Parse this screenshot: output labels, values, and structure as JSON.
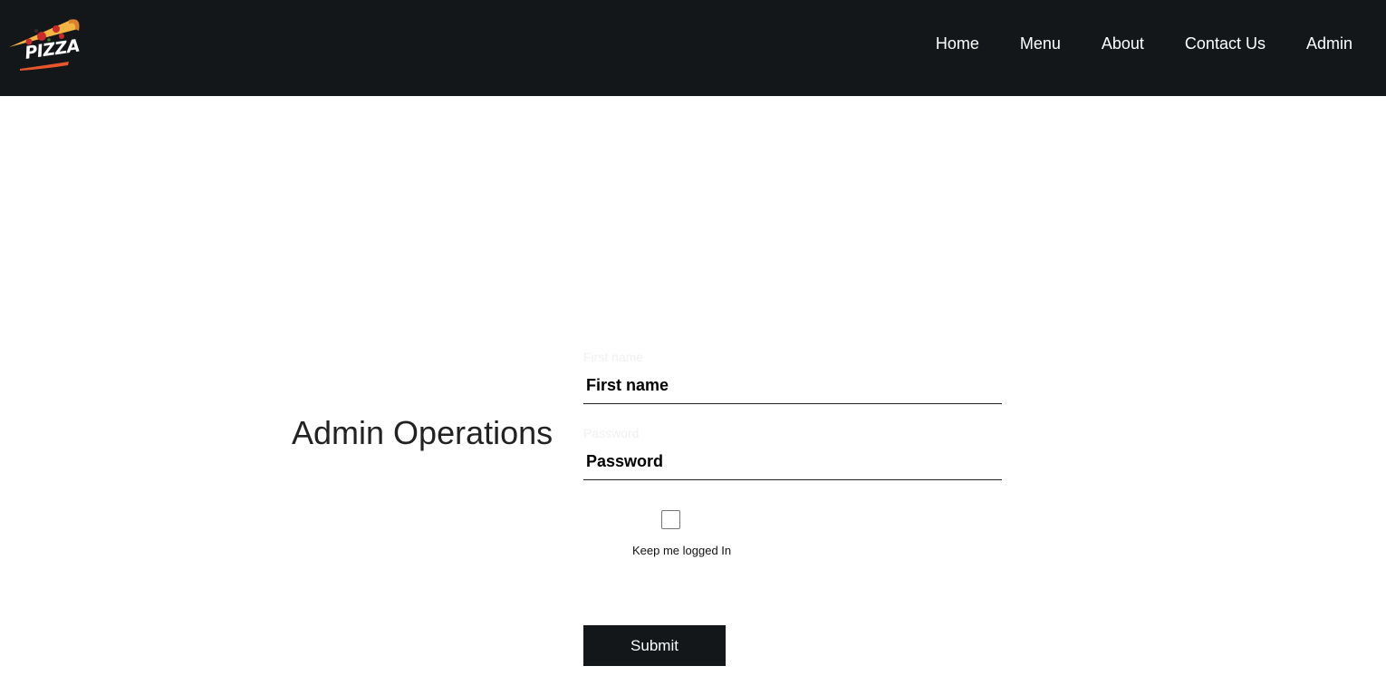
{
  "brand": {
    "logo_text": "PIZZA",
    "logo_icon": "pizza-slice-icon"
  },
  "nav": {
    "items": [
      {
        "label": "Home"
      },
      {
        "label": "Menu"
      },
      {
        "label": "About"
      },
      {
        "label": "Contact Us"
      },
      {
        "label": "Admin"
      }
    ]
  },
  "main": {
    "heading": "Admin Operations",
    "form": {
      "first_name": {
        "label": "First name",
        "placeholder": "First name",
        "value": ""
      },
      "password": {
        "label": "Password",
        "placeholder": "Password",
        "value": ""
      },
      "keep_logged_in": {
        "label": "Keep me logged In",
        "checked": false
      },
      "submit_label": "Submit"
    }
  },
  "colors": {
    "navbar_bg": "#14171a",
    "button_bg": "#14171a",
    "text_dark": "#222222"
  }
}
